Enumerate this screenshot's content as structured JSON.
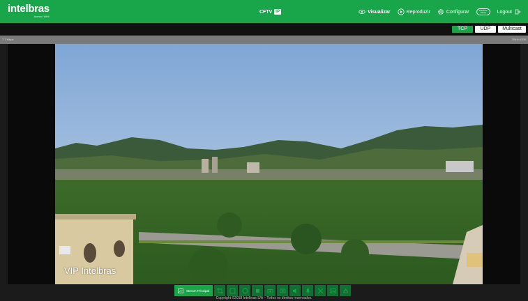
{
  "brand": {
    "logo": "intelbras",
    "subtitle": "Acesso Web"
  },
  "product": {
    "name": "CFTV",
    "badge": "IP"
  },
  "nav": [
    {
      "label": "Visualizar",
      "icon": "eye-icon",
      "active": true
    },
    {
      "label": "Reproduzir",
      "icon": "play-icon",
      "active": false
    },
    {
      "label": "Configurar",
      "icon": "gear-icon",
      "active": false
    },
    {
      "label": "Logout",
      "icon": "logout-icon",
      "active": false
    }
  ],
  "cloud": {
    "line1": "Intelbras",
    "line2": "Cloud"
  },
  "protocols": {
    "tcp": "TCP",
    "udp": "UDP",
    "multicast": "Multicast"
  },
  "stream_info": {
    "bitrate": "7.7 Mbps",
    "resolution": "2048×1536"
  },
  "video": {
    "osd_text": "VIP Intelbras"
  },
  "toolbar": {
    "stream_label": "Stream Principal",
    "icons": [
      "crop-icon",
      "fit-icon",
      "fisheye-icon",
      "brightness-icon",
      "snapshot-icon",
      "record-icon",
      "audio-icon",
      "mic-icon",
      "zoom-icon",
      "image-icon",
      "ptz-icon"
    ]
  },
  "footer": {
    "copyright": "Copyright ©2018 Intelbras S/A – Todos os direitos reservados."
  },
  "colors": {
    "accent": "#19a54a",
    "accent_dark": "#136e33"
  }
}
